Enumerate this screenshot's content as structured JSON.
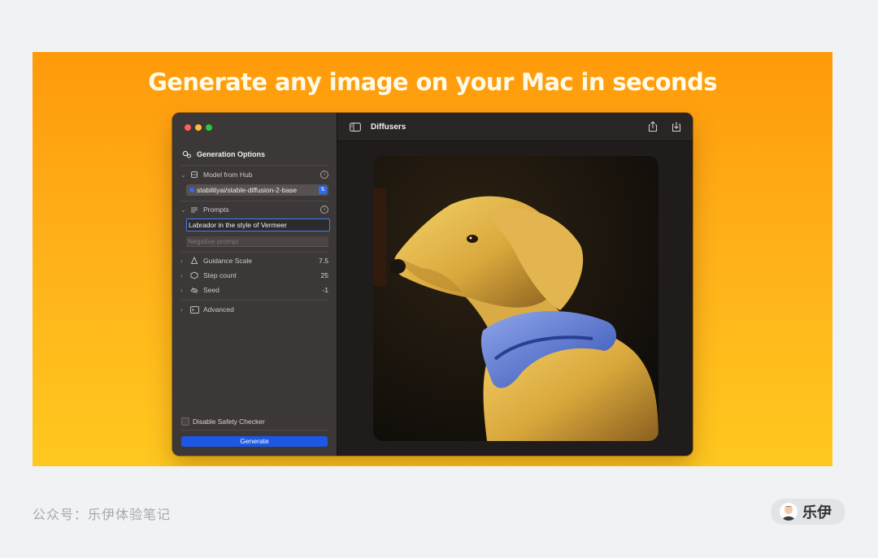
{
  "banner": {
    "headline": "Generate any image on your Mac in seconds"
  },
  "sidebar": {
    "section_title": "Generation Options",
    "model": {
      "label": "Model from Hub",
      "selected": "stabilityai/stable-diffusion-2-base"
    },
    "prompts": {
      "label": "Prompts",
      "prompt_value": "Labrador in the style of Vermeer",
      "negative_placeholder": "Negative prompt"
    },
    "params": [
      {
        "label": "Guidance Scale",
        "value": "7.5"
      },
      {
        "label": "Step count",
        "value": "25"
      },
      {
        "label": "Seed",
        "value": "-1"
      }
    ],
    "advanced_label": "Advanced",
    "safety_checkbox_label": "Disable Safety Checker",
    "generate_label": "Generate"
  },
  "window": {
    "title": "Diffusers"
  },
  "footer": {
    "watermark": "公众号：乐伊体验笔记",
    "author": "乐伊"
  },
  "colors": {
    "accent": "#1d57e3",
    "banner_top": "#ff9a0a",
    "banner_bottom": "#ffc81f",
    "sidebar_bg": "#3d3838"
  },
  "icons": [
    "gear-pair-icon",
    "chevron-down-icon",
    "chevron-right-icon",
    "cube-icon",
    "info-icon",
    "list-icon",
    "bell-icon",
    "box-icon",
    "sprout-icon",
    "terminal-icon",
    "sidebar-toggle-icon",
    "share-icon",
    "download-icon"
  ]
}
